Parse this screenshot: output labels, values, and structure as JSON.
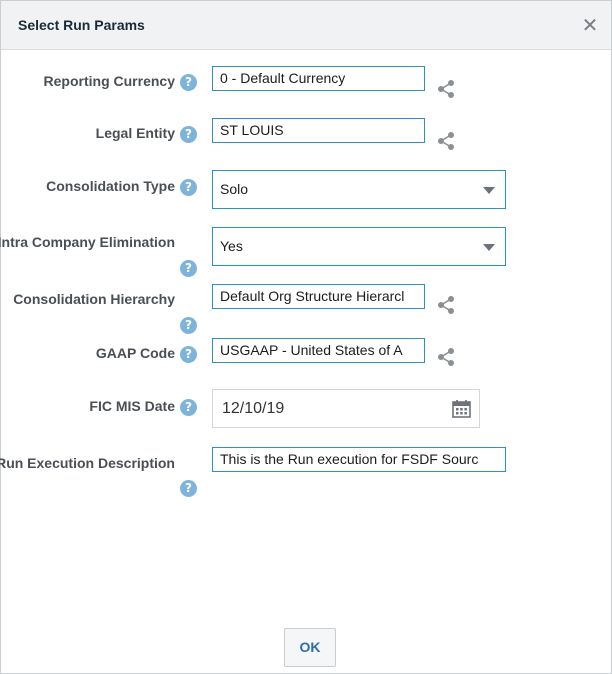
{
  "dialog": {
    "title": "Select Run Params",
    "close_glyph": "✕",
    "ok_label": "OK"
  },
  "help_glyph": "?",
  "fields": {
    "reporting_currency": {
      "label": "Reporting Currency",
      "value": "0 - Default Currency"
    },
    "legal_entity": {
      "label": "Legal Entity",
      "value": "ST LOUIS"
    },
    "consolidation_type": {
      "label": "Consolidation Type",
      "value": "Solo"
    },
    "intra_company_elimination": {
      "label": "Intra Company Elimination",
      "value": "Yes"
    },
    "consolidation_hierarchy": {
      "label": "Consolidation Hierarchy",
      "value": "Default Org Structure Hierarcl"
    },
    "gaap_code": {
      "label": "GAAP Code",
      "value": "USGAAP -  United States of A"
    },
    "fic_mis_date": {
      "label": "FIC MIS Date",
      "value": "12/10/19"
    },
    "run_execution_description": {
      "label": "Run Execution Description",
      "value": "This is the Run execution for FSDF Sourc"
    }
  },
  "icons": {
    "help": "help-icon",
    "hierarchy": "hierarchy-icon",
    "calendar": "calendar-icon",
    "dropdown": "chevron-down-icon"
  },
  "colors": {
    "field_border": "#2a90c7",
    "help_icon": "#7fb4da",
    "title_bar": "#f1f2f3",
    "ok_text": "#2e6ea8"
  }
}
